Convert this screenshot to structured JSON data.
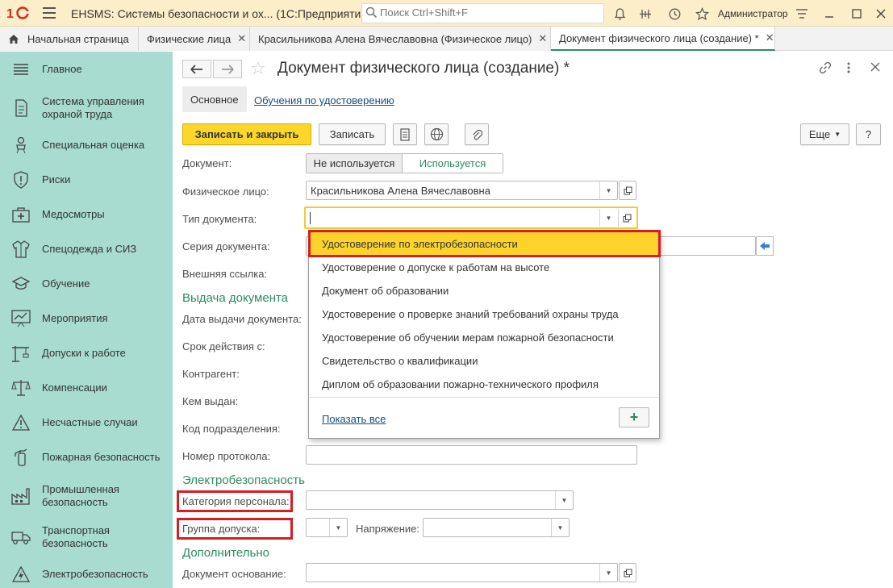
{
  "titlebar": {
    "app_title": "EHSMS: Системы безопасности и ох...  (1С:Предприятие)",
    "search_placeholder": "Поиск Ctrl+Shift+F",
    "user": "Администратор"
  },
  "tabs": [
    {
      "label": "Начальная страница"
    },
    {
      "label": "Физические лица"
    },
    {
      "label": "Красильникова Алена Вячеславовна (Физическое лицо)"
    },
    {
      "label": "Документ физического лица (создание) *"
    }
  ],
  "sidebar": {
    "items": [
      {
        "label": "Главное",
        "icon": "list-icon"
      },
      {
        "label": "Система управления охраной труда",
        "icon": "document-icon"
      },
      {
        "label": "Специальная оценка",
        "icon": "chair-icon"
      },
      {
        "label": "Риски",
        "icon": "shield-icon"
      },
      {
        "label": "Медосмотры",
        "icon": "medkit-icon"
      },
      {
        "label": "Спецодежда и СИЗ",
        "icon": "jacket-icon"
      },
      {
        "label": "Обучение",
        "icon": "graduation-icon"
      },
      {
        "label": "Мероприятия",
        "icon": "chart-board-icon"
      },
      {
        "label": "Допуски к работе",
        "icon": "crane-icon"
      },
      {
        "label": "Компенсации",
        "icon": "scales-icon"
      },
      {
        "label": "Несчастные случаи",
        "icon": "warning-icon"
      },
      {
        "label": "Пожарная безопасность",
        "icon": "extinguisher-icon"
      },
      {
        "label": "Промышленная безопасность",
        "icon": "factory-icon"
      },
      {
        "label": "Транспортная безопасность",
        "icon": "truck-icon"
      },
      {
        "label": "Электробезопасность",
        "icon": "lightning-icon"
      }
    ]
  },
  "form": {
    "title": "Документ физического лица (создание) *",
    "subtab_main": "Основное",
    "subtab_link": "Обучения по удостоверению",
    "buttons": {
      "save_close": "Записать и закрыть",
      "save": "Записать",
      "more": "Еще",
      "help": "?"
    },
    "fields": {
      "document_label": "Документ:",
      "toggle_off": "Не используется",
      "toggle_on": "Используется",
      "person_label": "Физическое лицо:",
      "person_value": "Красильникова Алена Вячеславовна",
      "doc_type_label": "Тип документа:",
      "doc_type_value": "",
      "series_label": "Серия документа:",
      "external_link_label": "Внешняя ссылка:",
      "section_issue": "Выдача документа",
      "issue_date_label": "Дата выдачи документа:",
      "validity_label": "Срок действия с:",
      "counterparty_label": "Контрагент:",
      "issued_by_label": "Кем выдан:",
      "dept_code_label": "Код подразделения:",
      "protocol_label": "Номер протокола:",
      "section_electric": "Электробезопасность",
      "personnel_category_label": "Категория персонала:",
      "access_group_label": "Группа допуска:",
      "voltage_label": "Напряжение:",
      "section_additional": "Дополнительно",
      "basis_doc_label": "Документ основание:"
    }
  },
  "dropdown": {
    "items": [
      "Удостоверение по электробезопасности",
      "Удостоверение о допуске к работам на высоте",
      "Документ об образовании",
      "Удостоверение о проверке знаний требований охраны труда",
      "Удостоверение об обучении мерам пожарной безопасности",
      "Свидетельство о квалификации",
      "Диплом об образовании пожарно-технического профиля"
    ],
    "show_all": "Показать все",
    "add": "+"
  },
  "colors": {
    "titlebar_bg": "#fbeec8",
    "sidebar_bg": "#a8dcd0",
    "accent_green": "#2c8c60",
    "primary_yellow": "#fcd72a",
    "highlight_red": "#d61c24"
  }
}
